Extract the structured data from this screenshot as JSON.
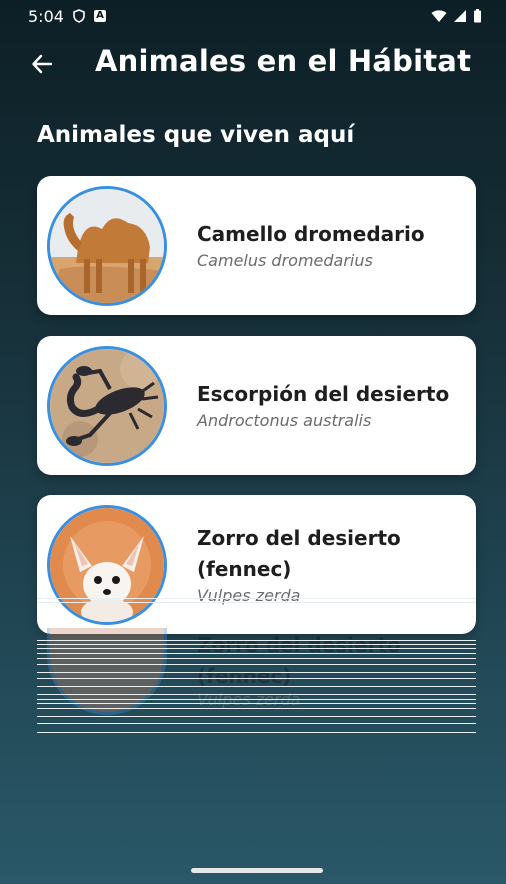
{
  "status_bar": {
    "time": "5:04"
  },
  "header": {
    "title": "Animales en el Hábitat"
  },
  "section": {
    "title": "Animales que viven aquí"
  },
  "animals": [
    {
      "common_name": "Camello dromedario",
      "scientific_name": "Camelus dromedarius",
      "image_icon": "camel-photo"
    },
    {
      "common_name": "Escorpión del desierto",
      "scientific_name": "Androctonus australis",
      "image_icon": "scorpion-photo"
    },
    {
      "common_name": "Zorro del desierto (fennec)",
      "scientific_name": "Vulpes zerda",
      "image_icon": "fennec-photo"
    }
  ],
  "colors": {
    "avatar_border": "#3a8fe0",
    "background_top": "#0d1f26",
    "background_bottom": "#2a5868"
  }
}
